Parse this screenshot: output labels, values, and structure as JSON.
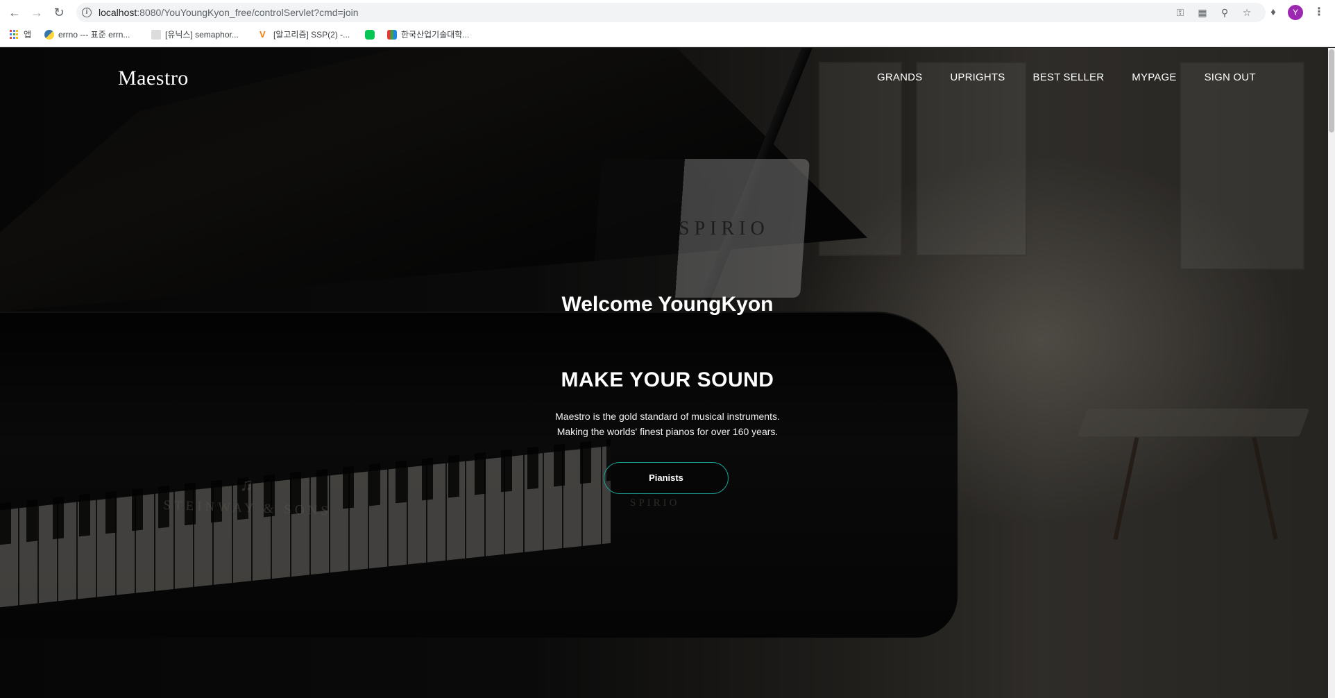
{
  "browser": {
    "url_host": "localhost",
    "url_rest": ":8080/YouYoungKyon_free/controlServlet?cmd=join",
    "avatar_letter": "Y",
    "bookmarks": [
      {
        "label": "앱"
      },
      {
        "label": "errno --- 표준 errn..."
      },
      {
        "label": "[유닉스] semaphor..."
      },
      {
        "label": "[알고리즘] SSP(2) -..."
      },
      {
        "label": ""
      },
      {
        "label": "한국산업기술대학..."
      }
    ]
  },
  "site": {
    "logo": "Maestro",
    "nav": [
      "GRANDS",
      "UPRIGHTS",
      "BEST SELLER",
      "MYPAGE",
      "SIGN OUT"
    ]
  },
  "hero": {
    "welcome": "Welcome YoungKyon",
    "headline": "MAKE YOUR SOUND",
    "desc_line1": "Maestro is the gold standard of musical instruments.",
    "desc_line2": "Making the worlds' finest pianos for over 160 years.",
    "cta_label": "Pianists",
    "image_brand": "STEINWAY & SONS",
    "image_logo": "SPIRIO",
    "image_logo_small": "SPIRIO"
  },
  "colors": {
    "cta_border": "#1a9e95",
    "avatar": "#9c27b0"
  }
}
